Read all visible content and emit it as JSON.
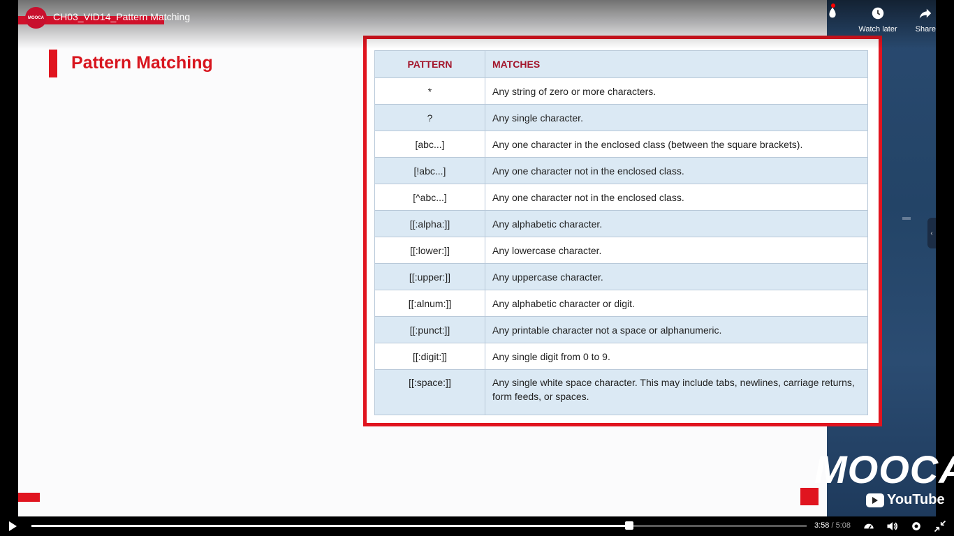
{
  "video": {
    "channel_logo_text": "MOOCA",
    "title": "CH03_VID14_Pattern Matching",
    "actions": [
      {
        "icon": "notification-icon",
        "label": ""
      },
      {
        "icon": "clock-icon",
        "label": "Watch later"
      },
      {
        "icon": "share-icon",
        "label": "Share"
      }
    ],
    "progress_fraction": 0.771,
    "time_current": "3:58",
    "time_separator": " / ",
    "time_total": "5:08"
  },
  "slide": {
    "title": "Pattern Matching",
    "table": {
      "headers": [
        "PATTERN",
        "MATCHES"
      ],
      "rows": [
        {
          "pattern": "*",
          "match": "Any string of zero or more characters."
        },
        {
          "pattern": "?",
          "match": "Any single character."
        },
        {
          "pattern": "[abc...]",
          "match": "Any one character in the enclosed class (between the square brackets)."
        },
        {
          "pattern": "[!abc...]",
          "match": "Any one character not in the enclosed class."
        },
        {
          "pattern": "[^abc...]",
          "match": "Any one character not in the enclosed class."
        },
        {
          "pattern": "[[:alpha:]]",
          "match": "Any alphabetic character."
        },
        {
          "pattern": "[[:lower:]]",
          "match": "Any lowercase character."
        },
        {
          "pattern": "[[:upper:]]",
          "match": "Any uppercase character."
        },
        {
          "pattern": "[[:alnum:]]",
          "match": "Any alphabetic character or digit."
        },
        {
          "pattern": "[[:punct:]]",
          "match": "Any printable character not a space or alphanumeric."
        },
        {
          "pattern": "[[:digit:]]",
          "match": "Any single digit from 0 to 9."
        },
        {
          "pattern": "[[:space:]]",
          "match": "Any single white space character. This may include tabs, newlines, carriage returns, form feeds, or spaces."
        }
      ]
    },
    "brand": {
      "mooca": "MOOCA",
      "youtube": "YouTube"
    }
  },
  "colors": {
    "accent_red": "#e0141f",
    "header_blue": "#dbe9f4",
    "header_text": "#a3152b"
  }
}
